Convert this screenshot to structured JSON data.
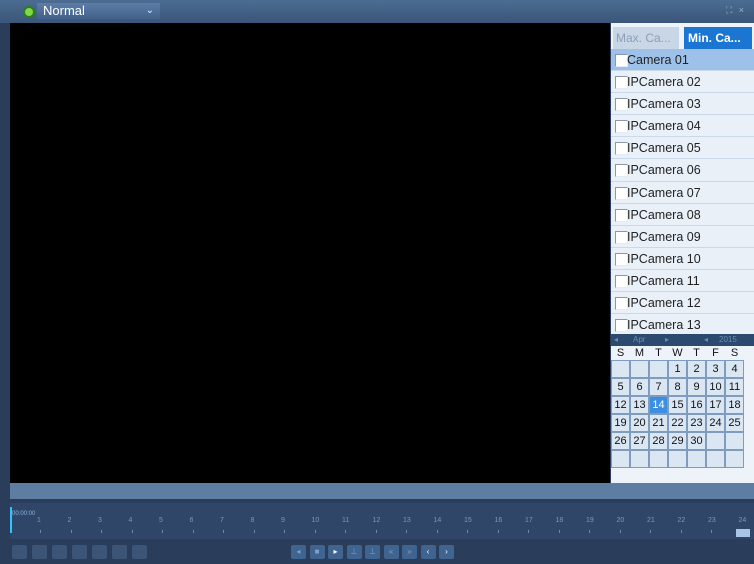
{
  "topbar": {
    "mode": "Normal",
    "mode_caret": "⌄",
    "right_icons": "⛶ ×"
  },
  "camera_tabs": {
    "max_label": "Max. Ca...",
    "min_label": "Min. Ca..."
  },
  "cameras": [
    {
      "name": "Camera 01",
      "selected": true
    },
    {
      "name": "IPCamera 02",
      "selected": false
    },
    {
      "name": "IPCamera 03",
      "selected": false
    },
    {
      "name": "IPCamera 04",
      "selected": false
    },
    {
      "name": "IPCamera 05",
      "selected": false
    },
    {
      "name": "IPCamera 06",
      "selected": false
    },
    {
      "name": "IPCamera 07",
      "selected": false
    },
    {
      "name": "IPCamera 08",
      "selected": false
    },
    {
      "name": "IPCamera 09",
      "selected": false
    },
    {
      "name": "IPCamera 10",
      "selected": false
    },
    {
      "name": "IPCamera 11",
      "selected": false
    },
    {
      "name": "IPCamera 12",
      "selected": false
    },
    {
      "name": "IPCamera 13",
      "selected": false
    }
  ],
  "calendar": {
    "month": "Apr",
    "year": "2015",
    "prev": "◂",
    "next": "▸",
    "weekdays": [
      "S",
      "M",
      "T",
      "W",
      "T",
      "F",
      "S"
    ],
    "weeks": [
      [
        "",
        "",
        "",
        "1",
        "2",
        "3",
        "4"
      ],
      [
        "5",
        "6",
        "7",
        "8",
        "9",
        "10",
        "11"
      ],
      [
        "12",
        "13",
        "14",
        "15",
        "16",
        "17",
        "18"
      ],
      [
        "19",
        "20",
        "21",
        "22",
        "23",
        "24",
        "25"
      ],
      [
        "26",
        "27",
        "28",
        "29",
        "30",
        "",
        ""
      ],
      [
        "",
        "",
        "",
        "",
        "",
        "",
        ""
      ]
    ],
    "today": "14"
  },
  "timeline": {
    "current_time": "00:00:00",
    "hours": [
      "1",
      "2",
      "3",
      "4",
      "5",
      "6",
      "7",
      "8",
      "9",
      "10",
      "11",
      "12",
      "13",
      "14",
      "15",
      "16",
      "17",
      "18",
      "19",
      "20",
      "21",
      "22",
      "23",
      "24"
    ]
  },
  "toolbar": {
    "left_icons": [
      "clip-icon",
      "add-tag-icon",
      "custom-tag-icon",
      "tag-manage-icon",
      "lock-icon",
      "zoom-icon",
      "scissors-icon"
    ],
    "playback": [
      {
        "name": "reverse-play-icon",
        "glyph": "◂",
        "on": false
      },
      {
        "name": "stop-icon",
        "glyph": "■",
        "on": false
      },
      {
        "name": "play-icon",
        "glyph": "▸",
        "on": true
      },
      {
        "name": "step-back-icon",
        "glyph": "⊥",
        "on": false
      },
      {
        "name": "step-forward-icon",
        "glyph": "⊥",
        "on": false
      },
      {
        "name": "slow-icon",
        "glyph": "«",
        "on": false
      },
      {
        "name": "fast-icon",
        "glyph": "»",
        "on": false
      },
      {
        "name": "prev-day-icon",
        "glyph": "‹",
        "on": true
      },
      {
        "name": "next-day-icon",
        "glyph": "›",
        "on": true
      }
    ]
  }
}
